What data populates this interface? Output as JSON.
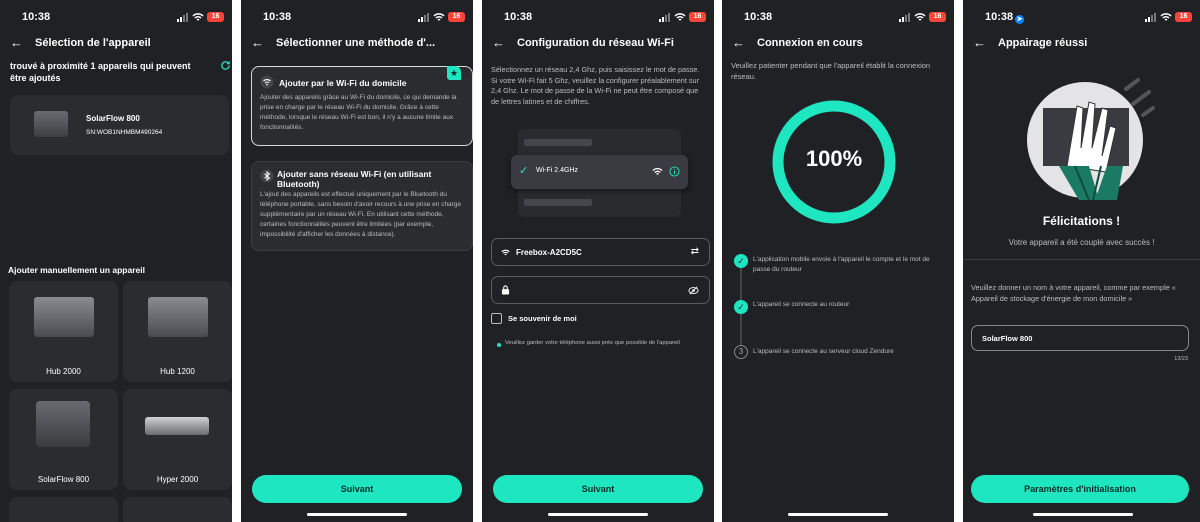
{
  "status": {
    "time": "10:38",
    "battery": "16"
  },
  "screen1": {
    "title": "Sélection de l'appareil",
    "found_text": "trouvé à proximité 1 appareils qui peuvent être ajoutés",
    "device_name": "SolarFlow 800",
    "device_sn": "SN:WOB1NHMBM490264",
    "manual_heading": "Ajouter manuellement un appareil",
    "tiles": [
      "Hub 2000",
      "Hub 1200",
      "SolarFlow 800",
      "Hyper 2000"
    ]
  },
  "screen2": {
    "title": "Sélectionner une méthode d'...",
    "opt1_title": "Ajouter par le Wi-Fi du domicile",
    "opt1_desc": "Ajouter des appareils grâce au Wi-Fi du domicile, ce qui demande la prise en charge par le réseau Wi-Fi du domicile. Grâce à cette méthode, lorsque le réseau Wi-Fi est bon, il n'y a aucune limite aux fonctionnalités.",
    "opt2_title": "Ajouter sans réseau Wi-Fi (en utilisant Bluetooth)",
    "opt2_desc": "L'ajout des appareils est effectué uniquement par le Bluetooth du téléphone portable, sans besoin d'avoir recours à une prise en charge supplémentaire par un réseau Wi-Fi. En utilisant cette méthode, certaines fonctionnalités peuvent être limitées (par exemple, impossibilité d'afficher les données à distance).",
    "button": "Suivant"
  },
  "screen3": {
    "title": "Configuration du réseau Wi-Fi",
    "intro": "Sélectionnez un réseau 2,4 Ghz, puis saisissez le mot de passe. Si votre Wi-Fi fait 5 Ghz, veuillez la configurer préalablement sur 2,4 Ghz. Le mot de passe de la Wi-Fi ne peut être composé que de lettres latines et de chiffres.",
    "wifi_option": "Wi-Fi  2.4GHz",
    "ssid": "Freebox-A2CD5C",
    "remember": "Se souvenir de moi",
    "hint": "Veuillez garder votre téléphone aussi près que possible de l'appareil",
    "button": "Suivant"
  },
  "screen4": {
    "title": "Connexion en cours",
    "intro": "Veuillez patienter pendant que l'appareil établit la connexion réseau.",
    "progress_text": "100%",
    "progress": 1.0,
    "steps": [
      "L'application mobile envoie à l'appareil le compte et le mot de passe du routeur",
      "L'appareil se connecte au routeur",
      "L'appareil se connecte au serveur cloud Zendure"
    ],
    "step3_num": "3"
  },
  "screen5": {
    "title": "Appairage réussi",
    "congrats": "Félicitations !",
    "sub": "Votre appareil a été couplé avec succès !",
    "prompt": "Veuillez donner un nom à votre appareil, comme par exemple « Appareil de stockage d'énergie de mon domicile »",
    "name_value": "SolarFlow 800",
    "counter": "13/23",
    "button": "Paramètres d'initialisation"
  },
  "colors": {
    "accent": "#1ee6c0",
    "background": "#202124",
    "card": "#2b2c30"
  }
}
